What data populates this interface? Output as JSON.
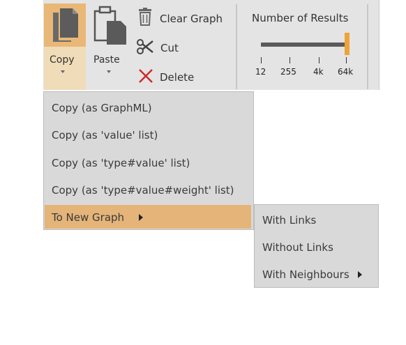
{
  "ribbon": {
    "copy_label": "Copy",
    "paste_label": "Paste",
    "clear_graph_label": "Clear Graph",
    "cut_label": "Cut",
    "delete_label": "Delete",
    "results": {
      "title": "Number of Results",
      "ticks": [
        "12",
        "255",
        "4k",
        "64k"
      ],
      "selected": "64k"
    }
  },
  "copy_menu": {
    "items": [
      "Copy (as GraphML)",
      "Copy (as 'value' list)",
      "Copy (as 'type#value' list)",
      "Copy (as 'type#value#weight' list)",
      "To New Graph"
    ]
  },
  "to_new_graph_submenu": {
    "items": [
      "With Links",
      "Without Links",
      "With Neighbours"
    ]
  },
  "colors": {
    "highlight": "#e4b479",
    "copy_button_active": "#e9b877",
    "slider_thumb": "#eea336",
    "delete_red": "#cc2a2a"
  }
}
